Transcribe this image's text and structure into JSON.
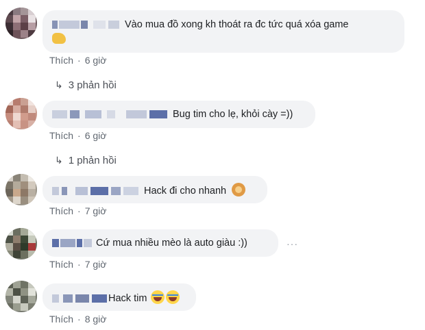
{
  "comments": [
    {
      "text": "Vào mua đồ xong kh thoát ra đc tức quá xóa game",
      "emoji_name": "fist-bump-emoji",
      "like_label": "Thích",
      "time": "6 giờ",
      "replies_label": "3 phản hồi"
    },
    {
      "text": "Bug tim cho lẹ, khỏi cày =))",
      "like_label": "Thích",
      "time": "6 giờ",
      "replies_label": "1 phản hồi"
    },
    {
      "text": "Hack đi cho nhanh",
      "emoji_name": "person-tipping-hand-emoji",
      "like_label": "Thích",
      "time": "7 giờ"
    },
    {
      "text": "Cứ mua nhiều mèo là auto giàu :))",
      "like_label": "Thích",
      "time": "7 giờ",
      "more_label": "···"
    },
    {
      "text": "Hack tim",
      "emoji_name": "tears-of-joy-emoji",
      "like_label": "Thích",
      "time": "8 giờ"
    }
  ],
  "reply_icon": "reply-arrow-icon",
  "separator": "·",
  "colors": {
    "bubble": "#f2f3f5",
    "meta_text": "#606770",
    "blurred_name": "#5c6fa8"
  }
}
